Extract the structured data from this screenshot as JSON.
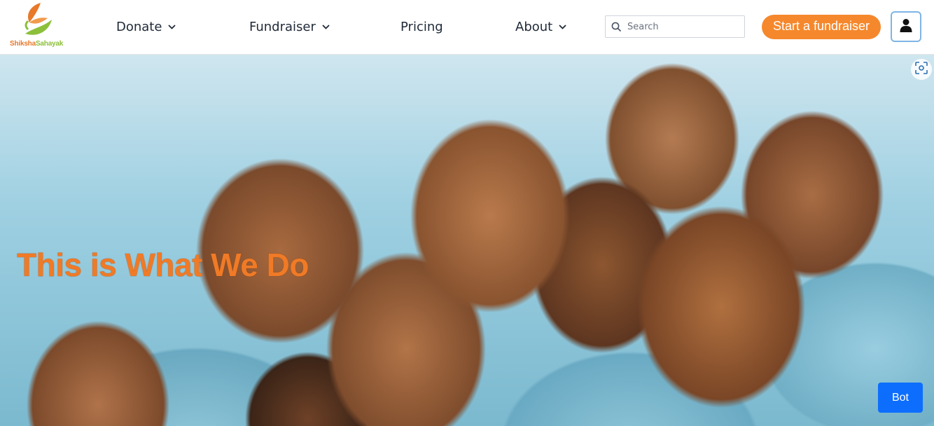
{
  "brand": {
    "name_part1": "Shiksha",
    "name_part2": "Sahayak"
  },
  "nav": {
    "items": [
      {
        "label": "Donate",
        "has_dropdown": true,
        "icon": "chevron-down-icon"
      },
      {
        "label": "Fundraiser",
        "has_dropdown": true,
        "icon": "chevron-down-icon"
      },
      {
        "label": "Pricing",
        "has_dropdown": false
      },
      {
        "label": "About",
        "has_dropdown": true,
        "icon": "chevron-down-icon"
      }
    ]
  },
  "search": {
    "placeholder": "Search",
    "value": "",
    "icon": "search-icon"
  },
  "cta": {
    "label": "Start a fundraiser"
  },
  "user": {
    "icon": "user-icon"
  },
  "hero": {
    "title": "This is What We Do",
    "scan_icon": "scan-icon"
  },
  "bot": {
    "label": "Bot"
  },
  "colors": {
    "accent_orange": "#f5882c",
    "logo_green": "#8cbf3a",
    "title_orange": "#f07a26",
    "bot_blue": "#0d6efd",
    "user_border": "#7fb5e6"
  }
}
